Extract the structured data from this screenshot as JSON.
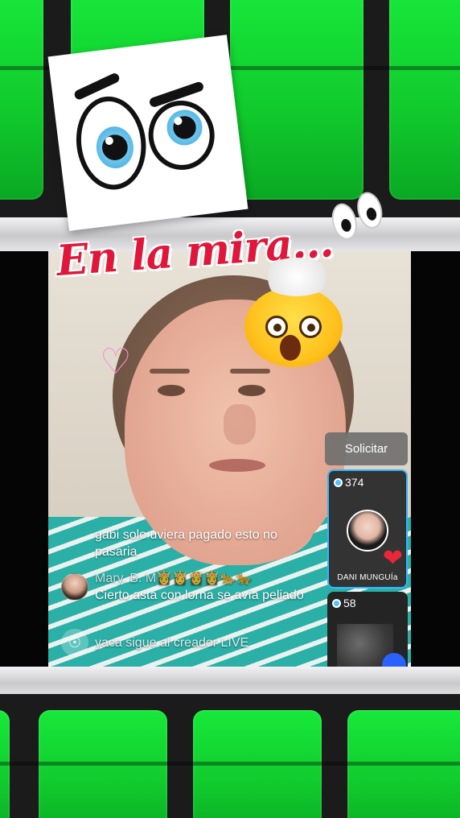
{
  "overlay": {
    "title": "En la mira...",
    "sticker_eyes_icon": "cartoon-eyes-icon",
    "emoji_mind_blown": "exploding-head-icon",
    "emoji_eyes": "eyes-icon",
    "pink_heart": "♡"
  },
  "live": {
    "request_button": "Solicitar",
    "comments": [
      {
        "user": "",
        "text": "gabi solo uviera pagado esto no pasaria"
      },
      {
        "user": "Mary. B. M👸👸👸👸🐆🐆",
        "text": "Cierto asta con lorna se avía peliado"
      }
    ],
    "follow_event": "yaca sigue al creador LIVE",
    "guests": [
      {
        "count": "374",
        "name": "DANI MUNGUÍa"
      },
      {
        "count": "58",
        "name": ""
      }
    ]
  },
  "colors": {
    "accent_green": "#12d632",
    "title_red": "#e0163a",
    "guest_border": "#2fb8ff"
  }
}
